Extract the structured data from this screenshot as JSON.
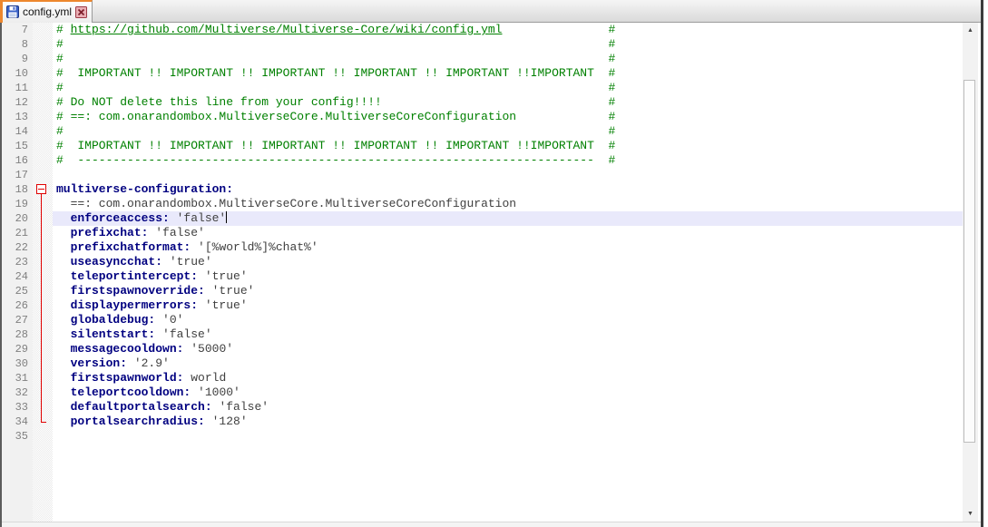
{
  "tab": {
    "title": "config.yml"
  },
  "colors": {
    "comment": "#008000",
    "key": "#000080",
    "value": "#404040",
    "fold": "#e00000",
    "current_line_bg": "#e9e9fb",
    "line_number": "#808080",
    "tab_accent": "#ed872d"
  },
  "scrollbar": {
    "up_arrow": "▲",
    "down_arrow": "▼"
  },
  "editor": {
    "lines": [
      {
        "num": 7,
        "tokens": [
          {
            "c": "c",
            "t": "# "
          },
          {
            "c": "l",
            "t": "https://github.com/Multiverse/Multiverse-Core/wiki/config.yml"
          },
          {
            "c": "c",
            "t": " ",
            "r": 15
          },
          {
            "c": "c",
            "t": "#"
          }
        ]
      },
      {
        "num": 8,
        "tokens": [
          {
            "c": "c",
            "t": "#"
          },
          {
            "c": "c",
            "t": " ",
            "r": 77
          },
          {
            "c": "c",
            "t": "#"
          }
        ]
      },
      {
        "num": 9,
        "tokens": [
          {
            "c": "c",
            "t": "#"
          },
          {
            "c": "c",
            "t": " ",
            "r": 77
          },
          {
            "c": "c",
            "t": "#"
          }
        ]
      },
      {
        "num": 10,
        "tokens": [
          {
            "c": "c",
            "t": "#  IMPORTANT !! IMPORTANT !! IMPORTANT !! IMPORTANT !! IMPORTANT !!IMPORTANT"
          },
          {
            "c": "c",
            "t": " ",
            "r": 2
          },
          {
            "c": "c",
            "t": "#"
          }
        ]
      },
      {
        "num": 11,
        "tokens": [
          {
            "c": "c",
            "t": "#"
          },
          {
            "c": "c",
            "t": " ",
            "r": 77
          },
          {
            "c": "c",
            "t": "#"
          }
        ]
      },
      {
        "num": 12,
        "tokens": [
          {
            "c": "c",
            "t": "# Do NOT delete this line from your config!!!!"
          },
          {
            "c": "c",
            "t": " ",
            "r": 32
          },
          {
            "c": "c",
            "t": "#"
          }
        ]
      },
      {
        "num": 13,
        "tokens": [
          {
            "c": "c",
            "t": "# ==: com.onarandombox.MultiverseCore.MultiverseCoreConfiguration"
          },
          {
            "c": "c",
            "t": " ",
            "r": 13
          },
          {
            "c": "c",
            "t": "#"
          }
        ]
      },
      {
        "num": 14,
        "tokens": [
          {
            "c": "c",
            "t": "#"
          },
          {
            "c": "c",
            "t": " ",
            "r": 77
          },
          {
            "c": "c",
            "t": "#"
          }
        ]
      },
      {
        "num": 15,
        "tokens": [
          {
            "c": "c",
            "t": "#  IMPORTANT !! IMPORTANT !! IMPORTANT !! IMPORTANT !! IMPORTANT !!IMPORTANT"
          },
          {
            "c": "c",
            "t": " ",
            "r": 2
          },
          {
            "c": "c",
            "t": "#"
          }
        ]
      },
      {
        "num": 16,
        "tokens": [
          {
            "c": "c",
            "t": "#  "
          },
          {
            "c": "c",
            "t": "-",
            "r": 73
          },
          {
            "c": "c",
            "t": " ",
            "r": 2
          },
          {
            "c": "c",
            "t": "#"
          }
        ]
      },
      {
        "num": 17,
        "tokens": []
      },
      {
        "num": 18,
        "fold": "start",
        "tokens": [
          {
            "c": "k",
            "t": "multiverse-configuration:"
          }
        ]
      },
      {
        "num": 19,
        "fold": "line",
        "tokens": [
          {
            "c": "v",
            "t": "  ==: com.onarandombox.MultiverseCore.MultiverseCoreConfiguration"
          }
        ]
      },
      {
        "num": 20,
        "fold": "line",
        "current": true,
        "tokens": [
          {
            "c": "k",
            "t": "  enforceaccess:"
          },
          {
            "c": "v",
            "t": " 'false'",
            "caret": true
          }
        ]
      },
      {
        "num": 21,
        "fold": "line",
        "tokens": [
          {
            "c": "k",
            "t": "  prefixchat:"
          },
          {
            "c": "v",
            "t": " 'false'"
          }
        ]
      },
      {
        "num": 22,
        "fold": "line",
        "tokens": [
          {
            "c": "k",
            "t": "  prefixchatformat:"
          },
          {
            "c": "v",
            "t": " '[%world%]%chat%'"
          }
        ]
      },
      {
        "num": 23,
        "fold": "line",
        "tokens": [
          {
            "c": "k",
            "t": "  useasyncchat:"
          },
          {
            "c": "v",
            "t": " 'true'"
          }
        ]
      },
      {
        "num": 24,
        "fold": "line",
        "tokens": [
          {
            "c": "k",
            "t": "  teleportintercept:"
          },
          {
            "c": "v",
            "t": " 'true'"
          }
        ]
      },
      {
        "num": 25,
        "fold": "line",
        "tokens": [
          {
            "c": "k",
            "t": "  firstspawnoverride:"
          },
          {
            "c": "v",
            "t": " 'true'"
          }
        ]
      },
      {
        "num": 26,
        "fold": "line",
        "tokens": [
          {
            "c": "k",
            "t": "  displaypermerrors:"
          },
          {
            "c": "v",
            "t": " 'true'"
          }
        ]
      },
      {
        "num": 27,
        "fold": "line",
        "tokens": [
          {
            "c": "k",
            "t": "  globaldebug:"
          },
          {
            "c": "v",
            "t": " '0'"
          }
        ]
      },
      {
        "num": 28,
        "fold": "line",
        "tokens": [
          {
            "c": "k",
            "t": "  silentstart:"
          },
          {
            "c": "v",
            "t": " 'false'"
          }
        ]
      },
      {
        "num": 29,
        "fold": "line",
        "tokens": [
          {
            "c": "k",
            "t": "  messagecooldown:"
          },
          {
            "c": "v",
            "t": " '5000'"
          }
        ]
      },
      {
        "num": 30,
        "fold": "line",
        "tokens": [
          {
            "c": "k",
            "t": "  version:"
          },
          {
            "c": "v",
            "t": " '2.9'"
          }
        ]
      },
      {
        "num": 31,
        "fold": "line",
        "tokens": [
          {
            "c": "k",
            "t": "  firstspawnworld:"
          },
          {
            "c": "v",
            "t": " world"
          }
        ]
      },
      {
        "num": 32,
        "fold": "line",
        "tokens": [
          {
            "c": "k",
            "t": "  teleportcooldown:"
          },
          {
            "c": "v",
            "t": " '1000'"
          }
        ]
      },
      {
        "num": 33,
        "fold": "line",
        "tokens": [
          {
            "c": "k",
            "t": "  defaultportalsearch:"
          },
          {
            "c": "v",
            "t": " 'false'"
          }
        ]
      },
      {
        "num": 34,
        "fold": "end",
        "tokens": [
          {
            "c": "k",
            "t": "  portalsearchradius:"
          },
          {
            "c": "v",
            "t": " '128'"
          }
        ]
      },
      {
        "num": 35,
        "tokens": []
      }
    ]
  }
}
